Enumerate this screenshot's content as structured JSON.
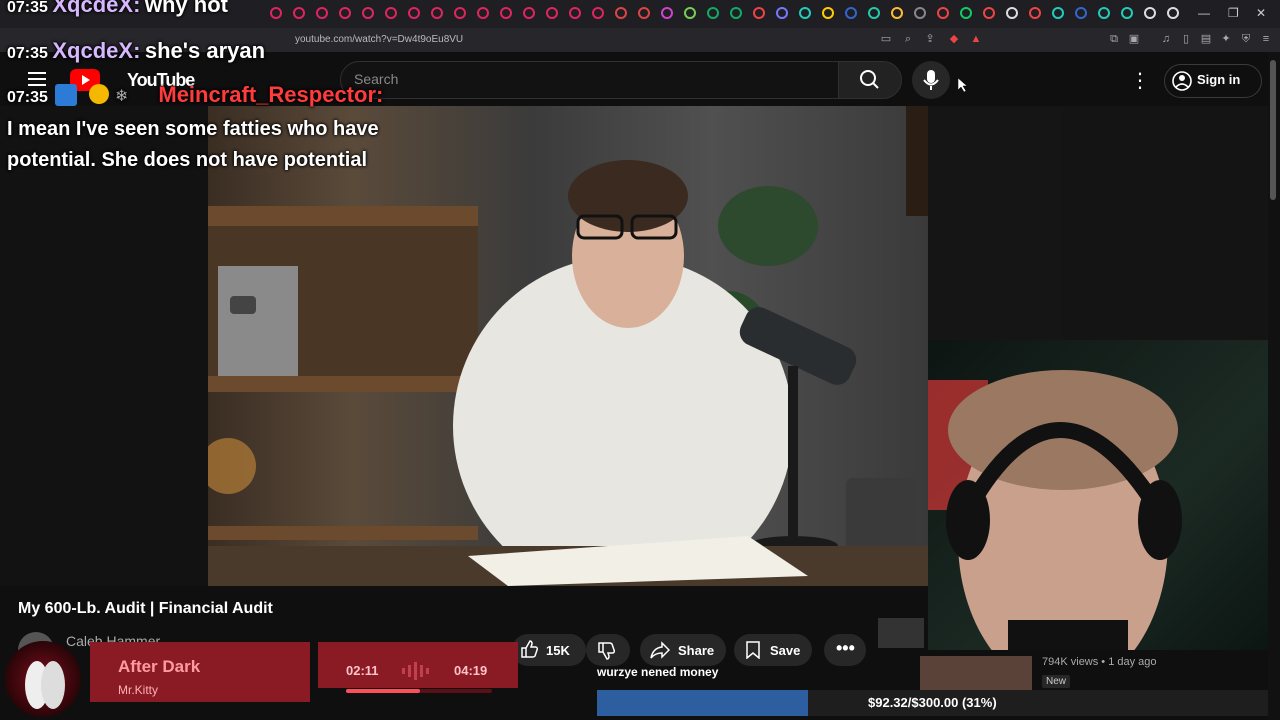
{
  "browser": {
    "url": "youtube.com/watch?v=Dw4t9oEu8VU",
    "tab_colors": [
      "#e0245e",
      "#e0245e",
      "#e0245e",
      "#e0245e",
      "#e0245e",
      "#e0245e",
      "#e0245e",
      "#e0245e",
      "#e0245e",
      "#e0245e",
      "#e0245e",
      "#e0245e",
      "#e0245e",
      "#e0245e",
      "#e0245e",
      "#d44",
      "#d44",
      "#c4c",
      "#7c5",
      "#1a6",
      "#1a6",
      "#e44",
      "#77f",
      "#2cb",
      "#fc0",
      "#36c",
      "#2ca",
      "#fb3",
      "#888",
      "#e44",
      "#1c6",
      "#e44",
      "#ddd",
      "#e44",
      "#2cb",
      "#36c",
      "#2cb",
      "#2cb",
      "#ddd",
      "#ddd"
    ]
  },
  "youtube": {
    "logo_text": "YouTube",
    "search_placeholder": "Search",
    "sign_in": "Sign in"
  },
  "chat": [
    {
      "time": "07:35",
      "user": "XqcdeX",
      "message": "why not"
    },
    {
      "time": "07:35",
      "user": "XqcdeX",
      "message": "she's aryan"
    },
    {
      "time": "07:35",
      "user": "Meincraft_Respector",
      "message": "I mean I've seen some fatties who have potential. She does not have potential"
    }
  ],
  "video": {
    "title": "My 600-Lb. Audit | Financial Audit",
    "channel": "Caleb Hammer",
    "likes": "15K",
    "share_label": "Share",
    "save_label": "Save"
  },
  "music": {
    "song": "After Dark",
    "artist": "Mr.Kitty",
    "current_time": "02:11",
    "total_time": "04:19",
    "progress": 0.51
  },
  "donation": {
    "label": "wurzye nened money",
    "progress_text": "$92.32/$300.00 (31%)",
    "progress": 0.31
  },
  "related": {
    "views_age": "794K views • 1 day ago",
    "badge": "New"
  }
}
